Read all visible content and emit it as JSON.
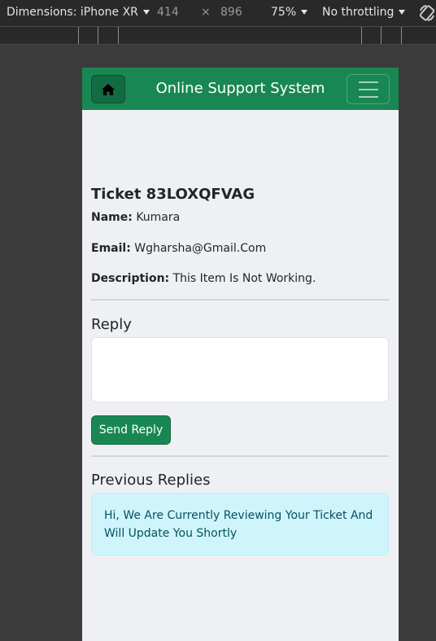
{
  "devtools": {
    "dimensions_label": "Dimensions: iPhone XR",
    "width": "414",
    "times": "×",
    "height": "896",
    "zoom": "75%",
    "throttling": "No throttling",
    "icons": {
      "caret": "chevron-down-icon",
      "rotate": "rotate-icon"
    }
  },
  "navbar": {
    "brand": "Online Support System",
    "home_icon": "home-icon",
    "menu_icon": "hamburger-menu-icon"
  },
  "ticket": {
    "title": "Ticket 83LOXQFVAG",
    "name_label": "Name:",
    "name": "Kumara",
    "email_label": "Email:",
    "email": "Wgharsha@Gmail.Com",
    "description_label": "Description:",
    "description": "This Item Is Not Working."
  },
  "reply": {
    "heading": "Reply",
    "textarea_value": "",
    "send_label": "Send Reply"
  },
  "previous": {
    "heading": "Previous Replies",
    "replies": [
      "Hi, We Are Currently Reviewing Your Ticket And Will Update You Shortly"
    ]
  },
  "colors": {
    "primary_green": "#198754",
    "alert_bg": "#cff4fc",
    "alert_text": "#055160",
    "page_bg": "#eff0f4"
  }
}
